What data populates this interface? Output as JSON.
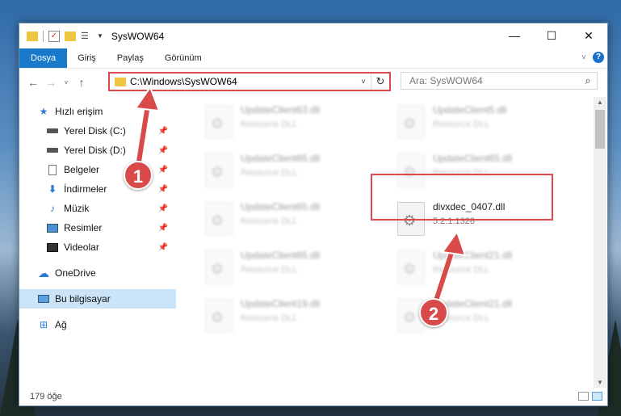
{
  "window": {
    "title": "SysWOW64"
  },
  "ribbon": {
    "tabs": [
      "Dosya",
      "Giriş",
      "Paylaş",
      "Görünüm"
    ]
  },
  "address": {
    "path": "C:\\Windows\\SysWOW64"
  },
  "search": {
    "placeholder": "Ara: SysWOW64"
  },
  "sidebar": {
    "items": [
      {
        "label": "Hızlı erişim",
        "icon": "star-icon"
      },
      {
        "label": "Yerel Disk (C:)",
        "icon": "drive-icon"
      },
      {
        "label": "Yerel Disk (D:)",
        "icon": "drive-icon"
      },
      {
        "label": "Belgeler",
        "icon": "documents-icon"
      },
      {
        "label": "İndirmeler",
        "icon": "download-icon"
      },
      {
        "label": "Müzik",
        "icon": "music-icon"
      },
      {
        "label": "Resimler",
        "icon": "pictures-icon"
      },
      {
        "label": "Videolar",
        "icon": "video-icon"
      },
      {
        "label": "OneDrive",
        "icon": "cloud-icon"
      },
      {
        "label": "Bu bilgisayar",
        "icon": "computer-icon"
      },
      {
        "label": "Ağ",
        "icon": "network-icon"
      }
    ]
  },
  "files": [
    {
      "name": "UpdateClient63.dll",
      "desc": "Resource DLL"
    },
    {
      "name": "UpdateClient5.dll",
      "desc": "Resource DLL"
    },
    {
      "name": "UpdateClient65.dll",
      "desc": "Resource DLL"
    },
    {
      "name": "UpdateClient65.dll",
      "desc": "Resource DLL"
    },
    {
      "name": "UpdateClient65.dll",
      "desc": "Resource DLL"
    },
    {
      "name": "divxdec_0407.dll",
      "desc": "5.2.1.1328"
    },
    {
      "name": "UpdateClient65.dll",
      "desc": "Resource DLL"
    },
    {
      "name": "UpdateClient21.dll",
      "desc": "Resource DLL"
    },
    {
      "name": "UpdateClient19.dll",
      "desc": "Resource DLL"
    },
    {
      "name": "UpdateClient21.dll",
      "desc": "Resource DLL"
    }
  ],
  "status": {
    "count": "179 öğe"
  },
  "markers": {
    "one": "1",
    "two": "2"
  },
  "colors": {
    "accent": "#1979ca",
    "highlight": "#d94b4b"
  }
}
